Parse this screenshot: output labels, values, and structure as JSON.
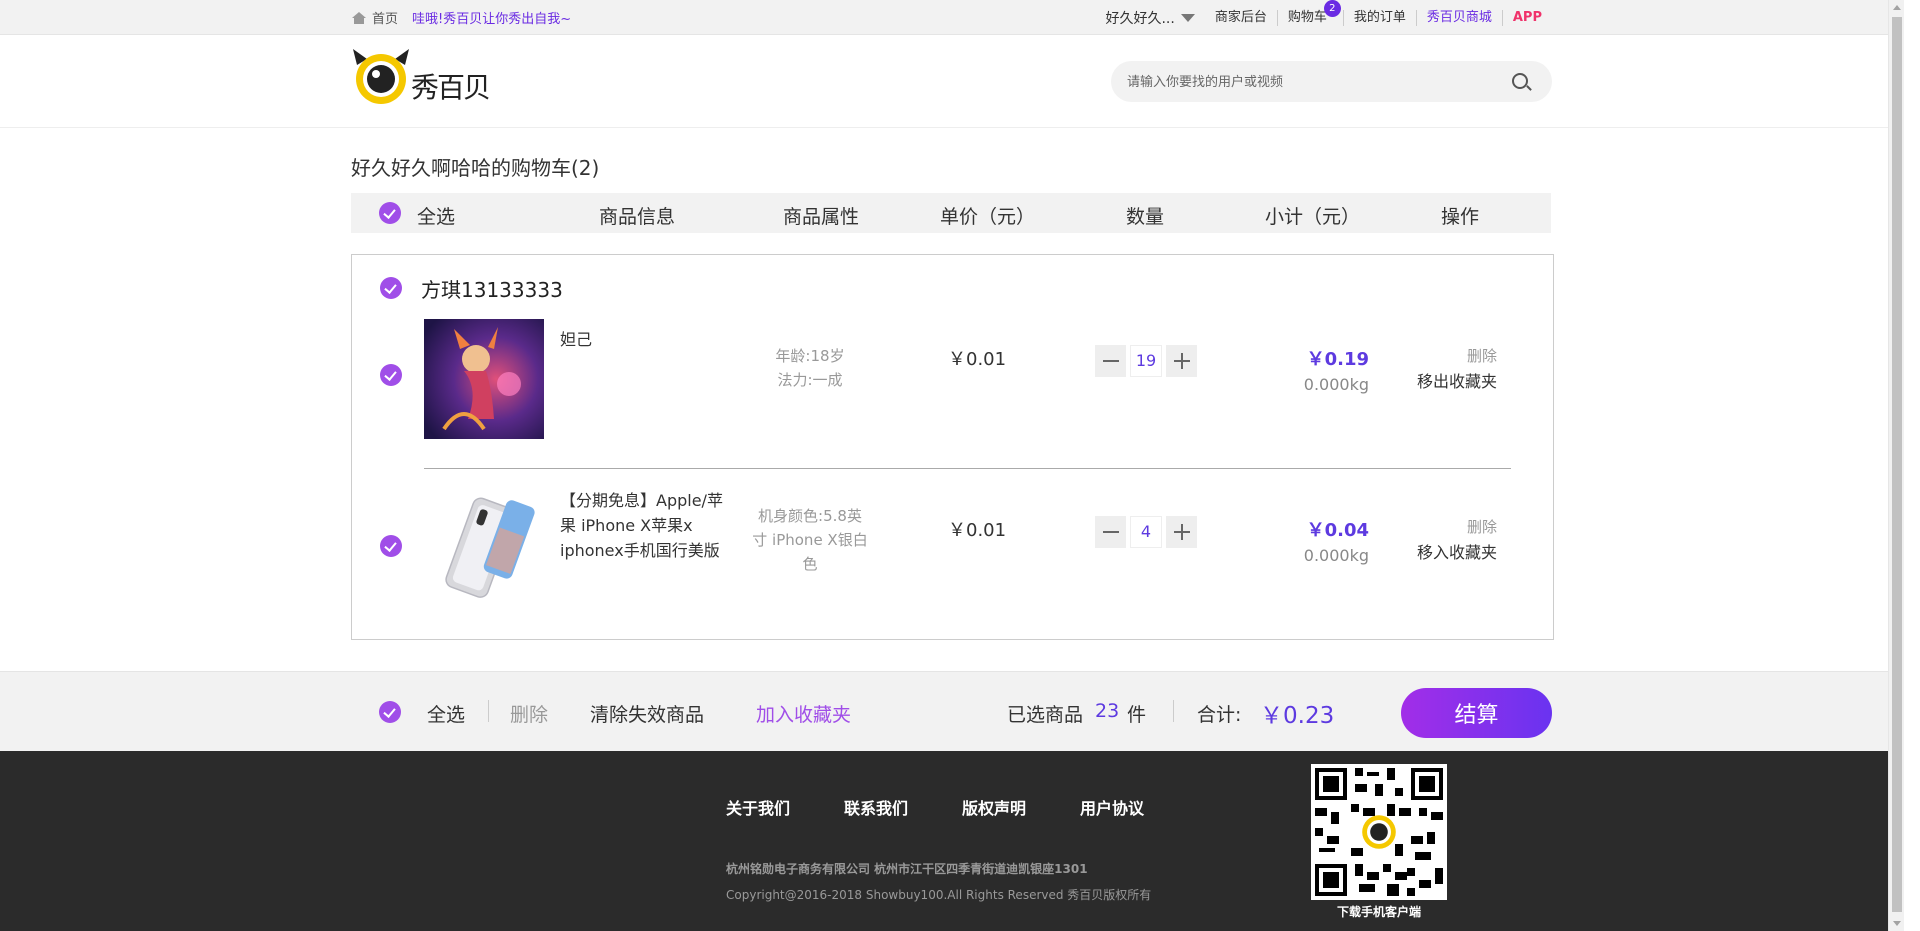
{
  "topbar": {
    "home": "首页",
    "slogan": "哇哦!秀百贝让你秀出自我~",
    "user": "好久好久...",
    "links": {
      "merchant": "商家后台",
      "cart": "购物车",
      "cart_count": "2",
      "orders": "我的订单",
      "mall": "秀百贝商城",
      "app": "APP"
    }
  },
  "header": {
    "logo_text": "秀百贝",
    "search_placeholder": "请输入你要找的用户或视频"
  },
  "cart": {
    "title": "好久好久啊哈哈的购物车(2)",
    "columns": {
      "select_all": "全选",
      "info": "商品信息",
      "attr": "商品属性",
      "price": "单价（元）",
      "qty": "数量",
      "subtotal": "小计（元）",
      "ops": "操作"
    },
    "shop_name": "方琪13133333",
    "items": [
      {
        "name": "妲己",
        "attr_lines": [
          "年龄:18岁",
          "法力:一成"
        ],
        "price": "￥0.01",
        "qty": "19",
        "subtotal": "￥0.19",
        "weight": "0.000kg",
        "delete": "删除",
        "fav_action": "移出收藏夹",
        "thumb_icon": "character-artwork-image"
      },
      {
        "name": "【分期免息】Apple/苹果 iPhone X苹果x iphonex手机国行美版",
        "attr_lines": [
          "机身颜色:5.8英寸 iPhone X银白色"
        ],
        "price": "￥0.01",
        "qty": "4",
        "subtotal": "￥0.04",
        "weight": "0.000kg",
        "delete": "删除",
        "fav_action": "移入收藏夹",
        "thumb_icon": "iphone-product-image"
      }
    ]
  },
  "bottombar": {
    "select_all": "全选",
    "delete": "删除",
    "clear_invalid": "清除失效商品",
    "add_fav": "加入收藏夹",
    "selected_prefix": "已选商品",
    "selected_count": "23",
    "selected_suffix": "件",
    "total_label": "合计:",
    "total_value": "￥0.23",
    "checkout": "结算"
  },
  "footer": {
    "links": [
      "关于我们",
      "联系我们",
      "版权声明",
      "用户协议"
    ],
    "address": "杭州铭勋电子商务有限公司  杭州市江干区四季青街道迪凯银座1301",
    "copyright": "Copyright@2016-2018 Showbuy100.All Rights Reserved  秀百贝版权所有",
    "qr_caption": "下载手机客户端"
  },
  "colors": {
    "brand_purple": "#6a2be3",
    "check_purple": "#a04ee8",
    "app_pink": "#f0326a",
    "footer_bg": "#2b2b2b"
  }
}
